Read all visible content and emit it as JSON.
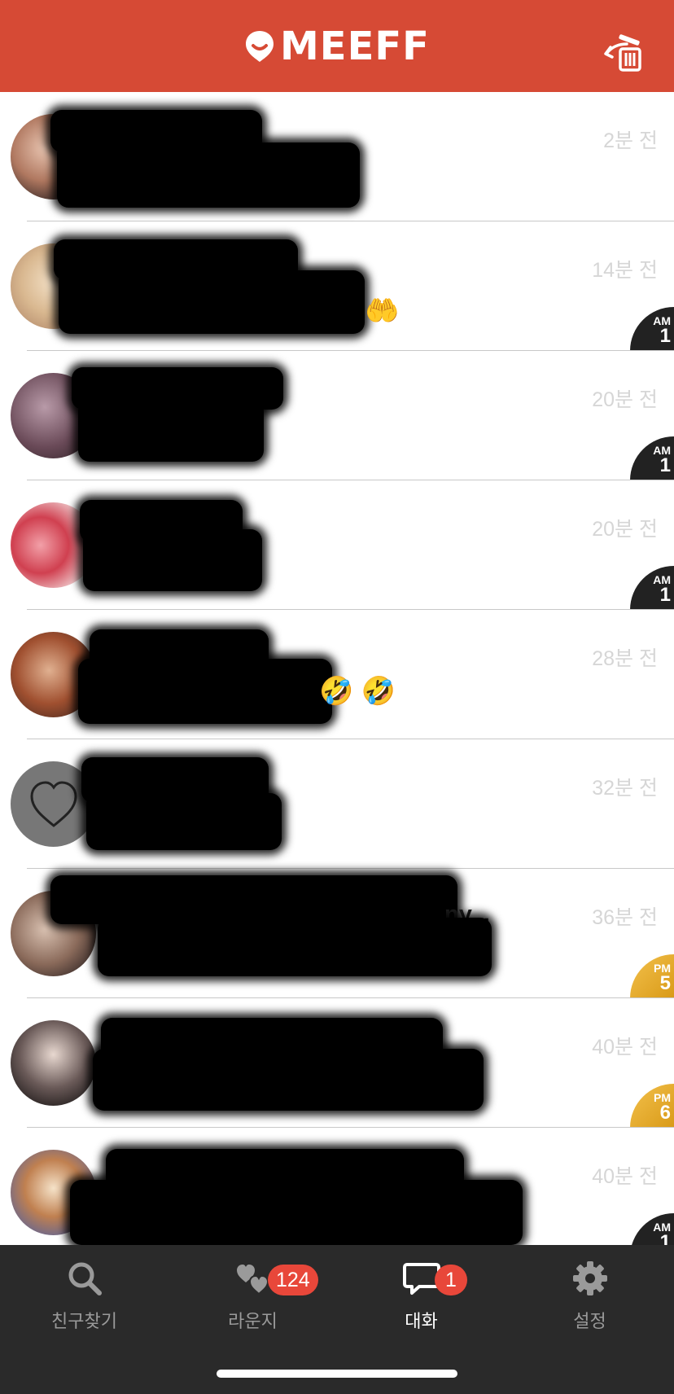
{
  "app": {
    "logo_text": "MEEFF",
    "brand_color": "#d64a35",
    "trash_icon": "restore-trash-icon"
  },
  "chats": [
    {
      "time": "2분 전",
      "ampm": null,
      "avatar": "photo"
    },
    {
      "time": "14분 전",
      "ampm": {
        "period": "AM",
        "hour": "1"
      },
      "avatar": "photo"
    },
    {
      "time": "20분 전",
      "ampm": {
        "period": "AM",
        "hour": "1"
      },
      "avatar": "photo"
    },
    {
      "time": "20분 전",
      "ampm": {
        "period": "AM",
        "hour": "1"
      },
      "avatar": "photo"
    },
    {
      "time": "28분 전",
      "ampm": null,
      "avatar": "photo",
      "emoji": "🤣 🤣"
    },
    {
      "time": "32분 전",
      "ampm": null,
      "avatar": "default"
    },
    {
      "time": "36분 전",
      "ampm": {
        "period": "PM",
        "hour": "5"
      },
      "avatar": "photo",
      "snippet_tail": "ny..."
    },
    {
      "time": "40분 전",
      "ampm": {
        "period": "PM",
        "hour": "6"
      },
      "avatar": "photo"
    },
    {
      "time": "40분 전",
      "ampm": {
        "period": "AM",
        "hour": "1"
      },
      "avatar": "photo"
    }
  ],
  "tabs": [
    {
      "label": "친구찾기",
      "icon": "search-icon",
      "badge": null
    },
    {
      "label": "라운지",
      "icon": "lounge-hearts-icon",
      "badge": "124"
    },
    {
      "label": "대화",
      "icon": "chat-bubble-icon",
      "badge": "1"
    },
    {
      "label": "설정",
      "icon": "gear-icon",
      "badge": null
    }
  ]
}
